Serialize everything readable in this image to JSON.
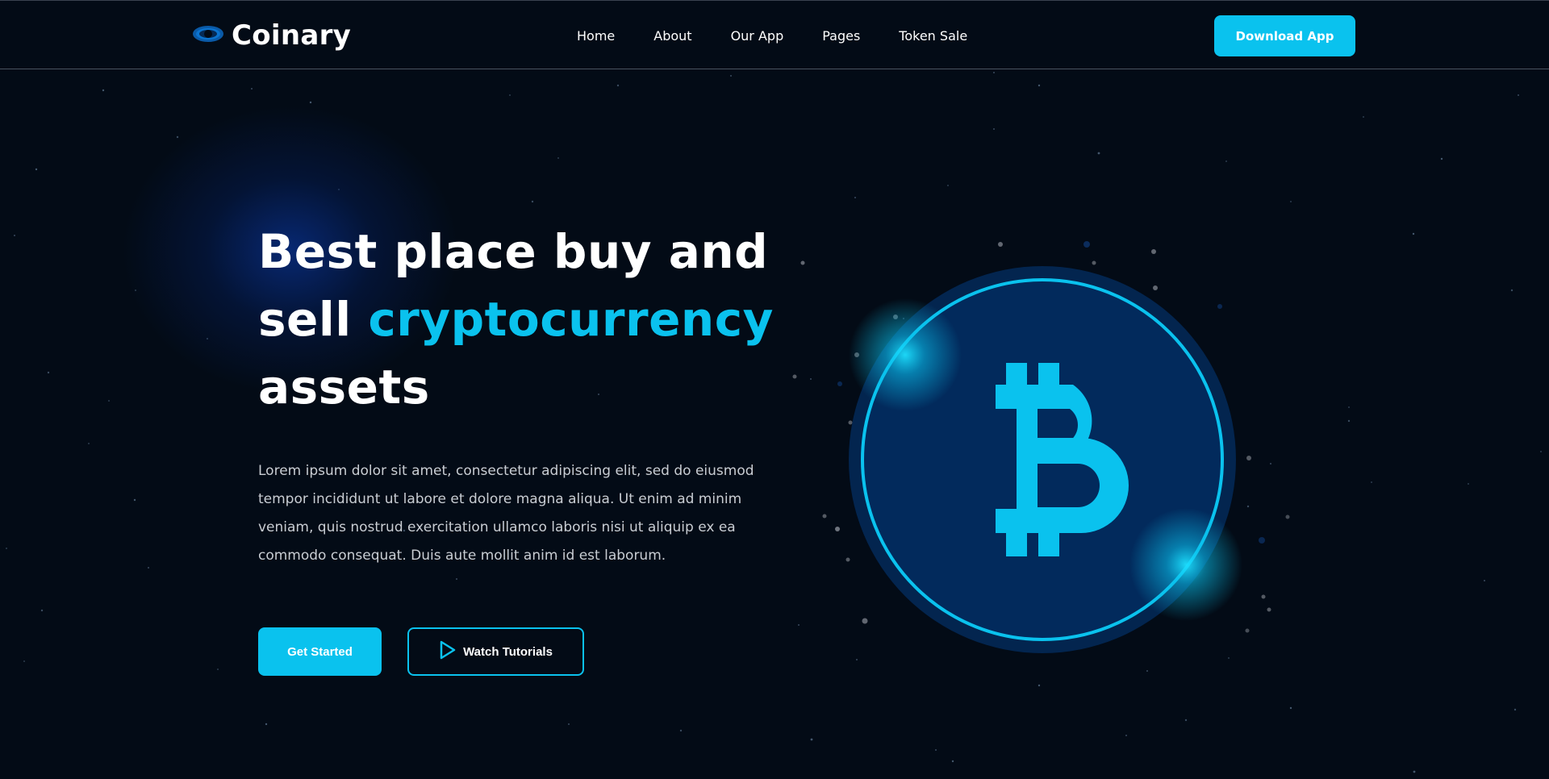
{
  "header": {
    "logo_text": "Coinary",
    "nav": [
      "Home",
      "About",
      "Our App",
      "Pages",
      "Token Sale"
    ],
    "download_label": "Download App"
  },
  "hero": {
    "title_line1": "Best place buy and",
    "title_line2_prefix": "sell ",
    "title_highlight": "cryptocurrency",
    "title_line3": "assets",
    "description": "Lorem ipsum dolor sit amet, consectetur adipiscing elit, sed do eiusmod tempor incididunt ut labore et dolore magna aliqua. Ut enim ad minim veniam, quis nostrud exercitation ullamco laboris nisi ut aliquip ex ea commodo consequat. Duis aute mollit anim id est laborum.",
    "primary_button": "Get Started",
    "secondary_button": "Watch Tutorials"
  },
  "colors": {
    "background": "#030b16",
    "accent": "#0ac2ee",
    "coin_fill": "#022a5c",
    "coin_outer": "#03254f"
  },
  "icons": {
    "logo": "eye-logo-icon",
    "play": "play-icon",
    "coin": "bitcoin-icon"
  }
}
